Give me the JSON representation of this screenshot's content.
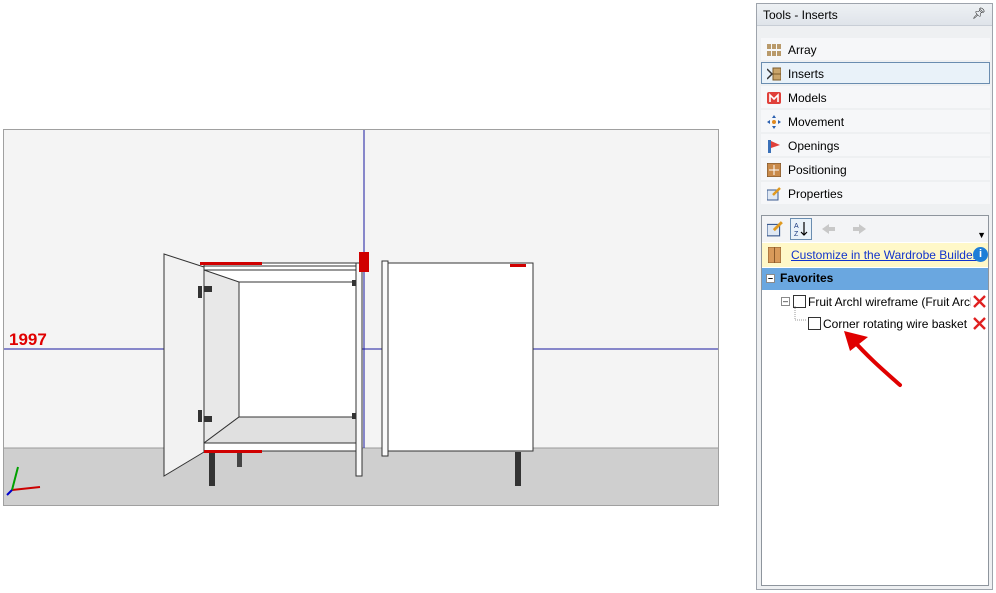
{
  "viewport": {
    "dimension_label": "1997"
  },
  "panel": {
    "title": "Tools - Inserts",
    "tools": [
      {
        "label": "Array",
        "icon": "array-icon",
        "selected": false
      },
      {
        "label": "Inserts",
        "icon": "inserts-icon",
        "selected": true
      },
      {
        "label": "Models",
        "icon": "models-icon",
        "selected": false
      },
      {
        "label": "Movement",
        "icon": "movement-icon",
        "selected": false
      },
      {
        "label": "Openings",
        "icon": "openings-icon",
        "selected": false
      },
      {
        "label": "Positioning",
        "icon": "positioning-icon",
        "selected": false
      },
      {
        "label": "Properties",
        "icon": "properties-icon",
        "selected": false
      }
    ],
    "customize_link": "Customize in the Wardrobe Builder",
    "favorites_label": "Favorites",
    "tree": [
      {
        "label": "Fruit Archl wireframe (Fruit Archl",
        "checked": false,
        "expanded": true
      },
      {
        "label": "Corner rotating wire basket",
        "checked": false
      }
    ]
  },
  "colors": {
    "accent_blue": "#6aa7e0",
    "annotation_red": "#e00000",
    "link_blue": "#1133cc"
  }
}
